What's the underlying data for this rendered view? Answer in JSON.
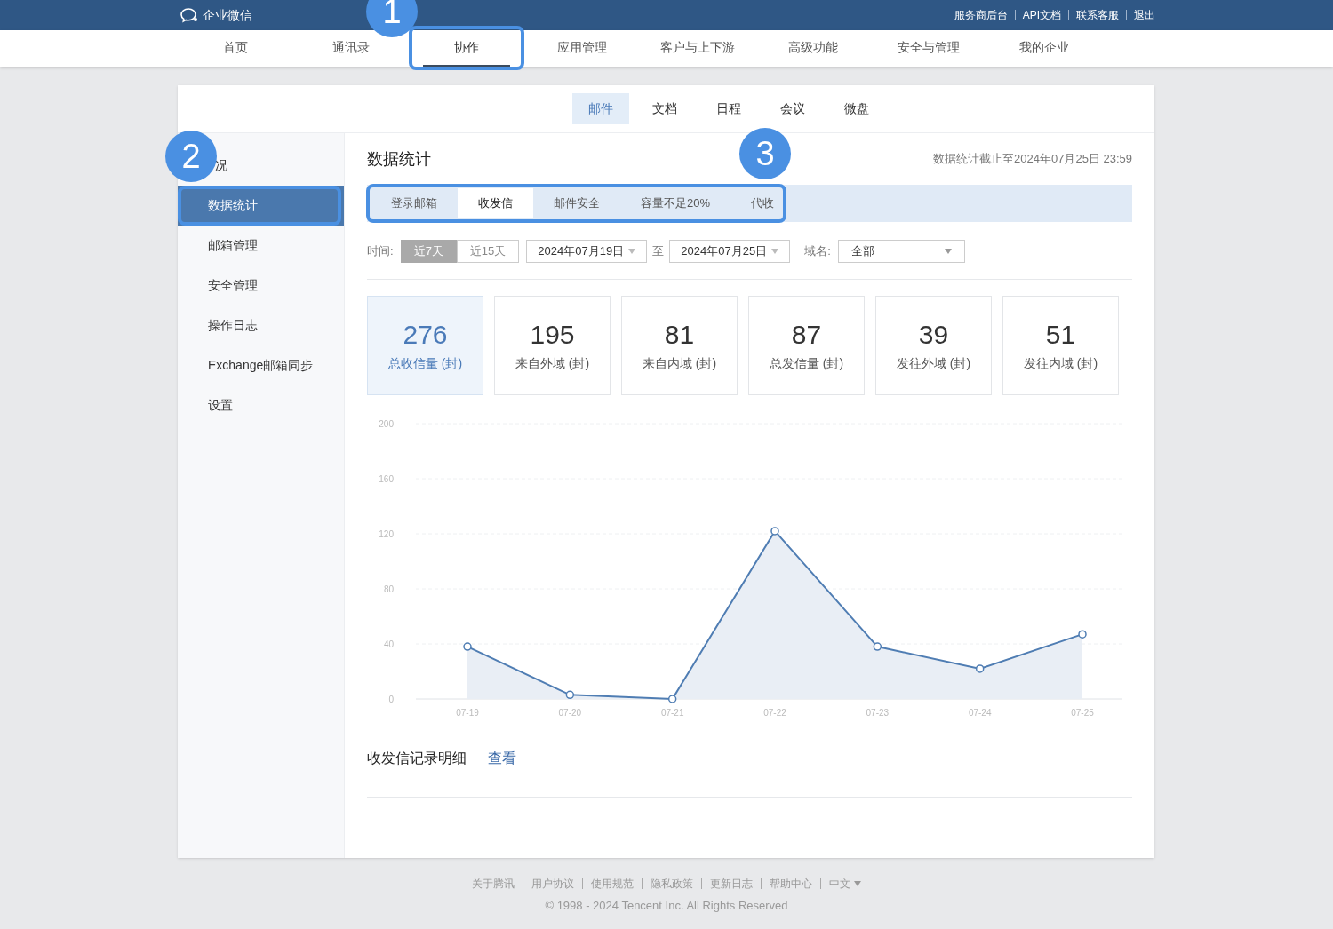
{
  "top_bar": {
    "logo": "企业微信",
    "links": [
      "服务商后台",
      "API文档",
      "联系客服",
      "退出"
    ]
  },
  "nav": {
    "callout": "1",
    "items": [
      {
        "label": "首页",
        "selected": false
      },
      {
        "label": "通讯录",
        "selected": false
      },
      {
        "label": "协作",
        "selected": true
      },
      {
        "label": "应用管理",
        "selected": false
      },
      {
        "label": "客户与上下游",
        "selected": false
      },
      {
        "label": "高级功能",
        "selected": false
      },
      {
        "label": "安全与管理",
        "selected": false
      },
      {
        "label": "我的企业",
        "selected": false
      }
    ]
  },
  "module_tabs": [
    {
      "label": "邮件",
      "selected": true
    },
    {
      "label": "文档",
      "selected": false
    },
    {
      "label": "日程",
      "selected": false
    },
    {
      "label": "会议",
      "selected": false
    },
    {
      "label": "微盘",
      "selected": false
    }
  ],
  "sidebar": {
    "callout": "2",
    "items": [
      {
        "label": "况",
        "selected": false
      },
      {
        "label": "数据统计",
        "selected": true
      },
      {
        "label": "邮箱管理",
        "selected": false
      },
      {
        "label": "安全管理",
        "selected": false
      },
      {
        "label": "操作日志",
        "selected": false
      },
      {
        "label": "Exchange邮箱同步",
        "selected": false
      },
      {
        "label": "设置",
        "selected": false
      }
    ]
  },
  "main": {
    "title": "数据统计",
    "as_of": "数据统计截止至2024年07月25日 23:59",
    "sub_tabs": {
      "callout": "3",
      "items": [
        {
          "label": "登录邮箱",
          "selected": false
        },
        {
          "label": "收发信",
          "selected": true
        },
        {
          "label": "邮件安全",
          "selected": false
        },
        {
          "label": "容量不足20%",
          "selected": false
        },
        {
          "label": "代收",
          "selected": false
        }
      ]
    },
    "filters": {
      "time_label": "时间:",
      "ranges": [
        {
          "label": "近7天",
          "selected": true
        },
        {
          "label": "近15天",
          "selected": false
        }
      ],
      "start_date": "2024年07月19日",
      "to": "至",
      "end_date": "2024年07月25日",
      "domain_label": "域名:",
      "domain": "全部"
    },
    "stats": [
      {
        "value": "276",
        "label": "总收信量 (封)",
        "selected": true
      },
      {
        "value": "195",
        "label": "来自外域 (封)",
        "selected": false
      },
      {
        "value": "81",
        "label": "来自内域 (封)",
        "selected": false
      },
      {
        "value": "87",
        "label": "总发信量 (封)",
        "selected": false
      },
      {
        "value": "39",
        "label": "发往外域 (封)",
        "selected": false
      },
      {
        "value": "51",
        "label": "发往内域 (封)",
        "selected": false
      }
    ],
    "chart_data": {
      "type": "area",
      "categories": [
        "07-19",
        "07-20",
        "07-21",
        "07-22",
        "07-23",
        "07-24",
        "07-25"
      ],
      "series": [
        {
          "color": "#4f7db3",
          "values": [
            38,
            3,
            0,
            122,
            38,
            22,
            47
          ]
        }
      ],
      "grid": true,
      "ylim": [
        0,
        200
      ],
      "yticks": [
        0,
        40,
        80,
        120,
        160,
        200
      ]
    },
    "details": {
      "label": "收发信记录明细",
      "link": "查看"
    }
  },
  "footer": {
    "links": [
      "关于腾讯",
      "用户协议",
      "使用规范",
      "隐私政策",
      "更新日志",
      "帮助中心"
    ],
    "language": "中文",
    "copyright": "© 1998 - 2024 Tencent Inc. All Rights Reserved"
  }
}
